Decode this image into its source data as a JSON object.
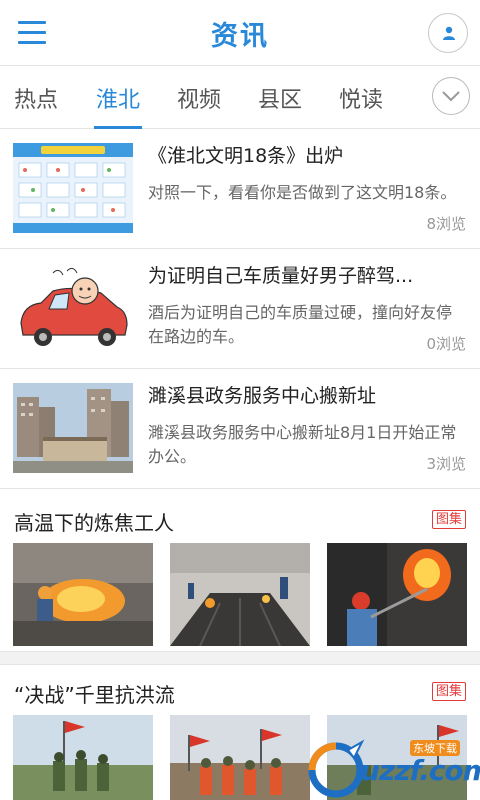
{
  "header": {
    "title": "资讯"
  },
  "tabs": [
    {
      "label": "热点"
    },
    {
      "label": "淮北"
    },
    {
      "label": "视频"
    },
    {
      "label": "县区"
    },
    {
      "label": "悦读"
    }
  ],
  "active_tab": "淮北",
  "news": [
    {
      "title": "《淮北文明18条》出炉",
      "desc": "对照一下，看看你是否做到了这文明18条。",
      "views": "8浏览"
    },
    {
      "title": "为证明自己车质量好男子醉驾...",
      "desc": "酒后为证明自己的车质量过硬，撞向好友停在路边的车。",
      "views": "0浏览"
    },
    {
      "title": "濉溪县政务服务中心搬新址",
      "desc": "濉溪县政务服务中心搬新址8月1日开始正常办公。",
      "views": "3浏览"
    }
  ],
  "galleries": [
    {
      "title": "高温下的炼焦工人",
      "badge": "图集"
    },
    {
      "title": "“决战”千里抗洪流",
      "badge": "图集"
    }
  ],
  "watermark": {
    "text": "uzzf.com",
    "sub": "东坡下载"
  },
  "icons": {
    "menu": "menu-icon",
    "user": "user-icon",
    "more": "chevron-down-icon"
  },
  "colors": {
    "accent": "#2a88d8",
    "badge": "#e23b3b",
    "text": "#222222",
    "muted": "#999999"
  }
}
